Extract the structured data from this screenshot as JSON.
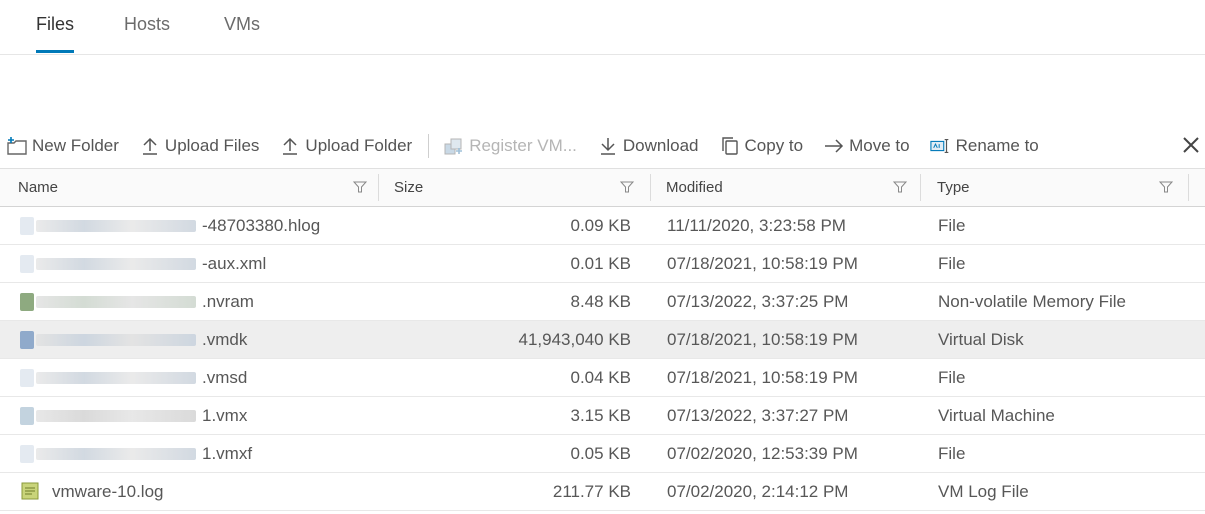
{
  "tabs": [
    {
      "label": "Files",
      "active": true
    },
    {
      "label": "Hosts",
      "active": false
    },
    {
      "label": "VMs",
      "active": false
    }
  ],
  "toolbar": {
    "new_folder": "New Folder",
    "upload_files": "Upload Files",
    "upload_folder": "Upload Folder",
    "register_vm": "Register VM...",
    "download": "Download",
    "copy_to": "Copy to",
    "move_to": "Move to",
    "rename_to": "Rename to"
  },
  "columns": [
    "Name",
    "Size",
    "Modified",
    "Type"
  ],
  "rows": [
    {
      "name": "-48703380.hlog",
      "size": "0.09 KB",
      "modified": "11/11/2020, 3:23:58 PM",
      "type": "File",
      "icon": "file-icon"
    },
    {
      "name": "-aux.xml",
      "size": "0.01 KB",
      "modified": "07/18/2021, 10:58:19 PM",
      "type": "File",
      "icon": "file-icon"
    },
    {
      "name": ".nvram",
      "size": "8.48 KB",
      "modified": "07/13/2022, 3:37:25 PM",
      "type": "Non-volatile Memory File",
      "icon": "nvram-icon"
    },
    {
      "name": ".vmdk",
      "size": "41,943,040 KB",
      "modified": "07/18/2021, 10:58:19 PM",
      "type": "Virtual Disk",
      "icon": "disk-icon",
      "selected": true
    },
    {
      "name": ".vmsd",
      "size": "0.04 KB",
      "modified": "07/18/2021, 10:58:19 PM",
      "type": "File",
      "icon": "file-icon"
    },
    {
      "name": "1.vmx",
      "size": "3.15 KB",
      "modified": "07/13/2022, 3:37:27 PM",
      "type": "Virtual Machine",
      "icon": "vm-icon"
    },
    {
      "name": "1.vmxf",
      "size": "0.05 KB",
      "modified": "07/02/2020, 12:53:39 PM",
      "type": "File",
      "icon": "file-icon"
    },
    {
      "name": "vmware-10.log",
      "size": "211.77 KB",
      "modified": "07/02/2020, 2:14:12 PM",
      "type": "VM Log File",
      "icon": "log-file-icon"
    }
  ],
  "colors": {
    "accent": "#0079b8",
    "selected_row": "#eeeeee",
    "header_bg": "#fafafa"
  }
}
